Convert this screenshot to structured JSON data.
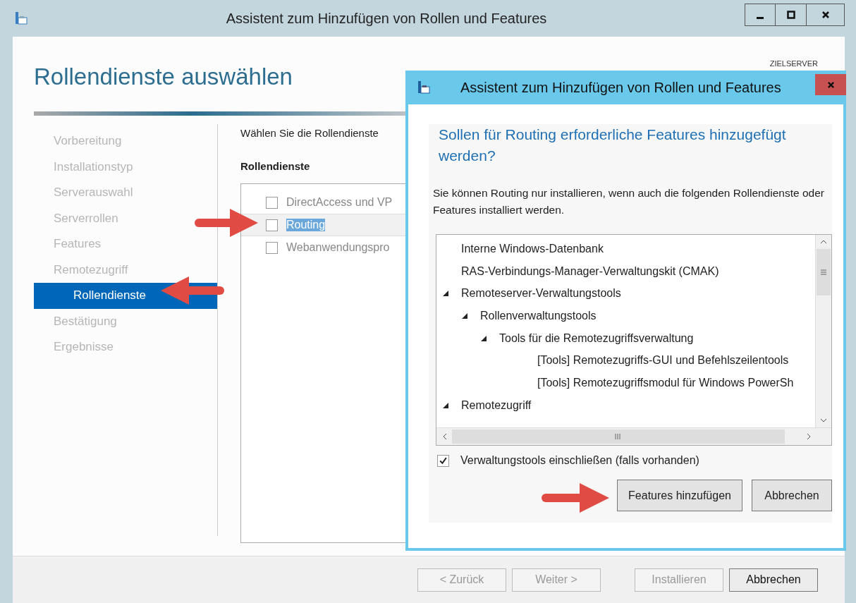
{
  "window": {
    "title": "Assistent zum Hinzufügen von Rollen und Features"
  },
  "page": {
    "title": "Rollendienste auswählen",
    "target_server_label": "ZIELSERVER"
  },
  "steps": [
    {
      "label": "Vorbereitung",
      "selected": false
    },
    {
      "label": "Installationstyp",
      "selected": false
    },
    {
      "label": "Serverauswahl",
      "selected": false
    },
    {
      "label": "Serverrollen",
      "selected": false
    },
    {
      "label": "Features",
      "selected": false
    },
    {
      "label": "Remotezugriff",
      "selected": false
    },
    {
      "label": "Rollendienste",
      "selected": true
    },
    {
      "label": "Bestätigung",
      "selected": false
    },
    {
      "label": "Ergebnisse",
      "selected": false
    }
  ],
  "content": {
    "intro": "Wählen Sie die Rollendienste",
    "list_heading": "Rollendienste",
    "role_services": [
      {
        "label": "DirectAccess und VP",
        "checked": false,
        "selected": false
      },
      {
        "label": "Routing",
        "checked": false,
        "selected": true
      },
      {
        "label": "Webanwendungspro",
        "checked": false,
        "selected": false
      }
    ]
  },
  "footer_buttons": [
    {
      "label": "< Zurück",
      "disabled": true
    },
    {
      "label": "Weiter >",
      "disabled": true
    },
    {
      "label": "Installieren",
      "disabled": true
    },
    {
      "label": "Abbrechen",
      "disabled": false
    }
  ],
  "dialog": {
    "title": "Assistent zum Hinzufügen von Rollen und Features",
    "heading": "Sollen für Routing erforderliche Features hinzugefügt werden?",
    "message": "Sie können Routing nur installieren, wenn auch die folgenden Rollendienste oder Features installiert werden.",
    "tree": [
      {
        "label": "Interne Windows-Datenbank"
      },
      {
        "label": "RAS-Verbindungs-Manager-Verwaltungskit (CMAK)"
      },
      {
        "label": "Remoteserver-Verwaltungstools",
        "expanded": true,
        "children": [
          {
            "label": "Rollenverwaltungstools",
            "expanded": true,
            "children": [
              {
                "label": "Tools für die Remotezugriffsverwaltung",
                "expanded": true,
                "children": [
                  {
                    "label": "[Tools] Remotezugriffs-GUI und Befehlszeilentools"
                  },
                  {
                    "label": "[Tools] Remotezugriffsmodul für Windows PowerSh"
                  }
                ]
              }
            ]
          }
        ]
      },
      {
        "label": "Remotezugriff",
        "expanded": true
      }
    ],
    "include_tools": {
      "label": "Verwaltungstools einschließen (falls vorhanden)",
      "checked": true
    },
    "buttons": [
      {
        "label": "Features hinzufügen",
        "kind": "primary"
      },
      {
        "label": "Abbrechen",
        "kind": "normal"
      }
    ]
  }
}
